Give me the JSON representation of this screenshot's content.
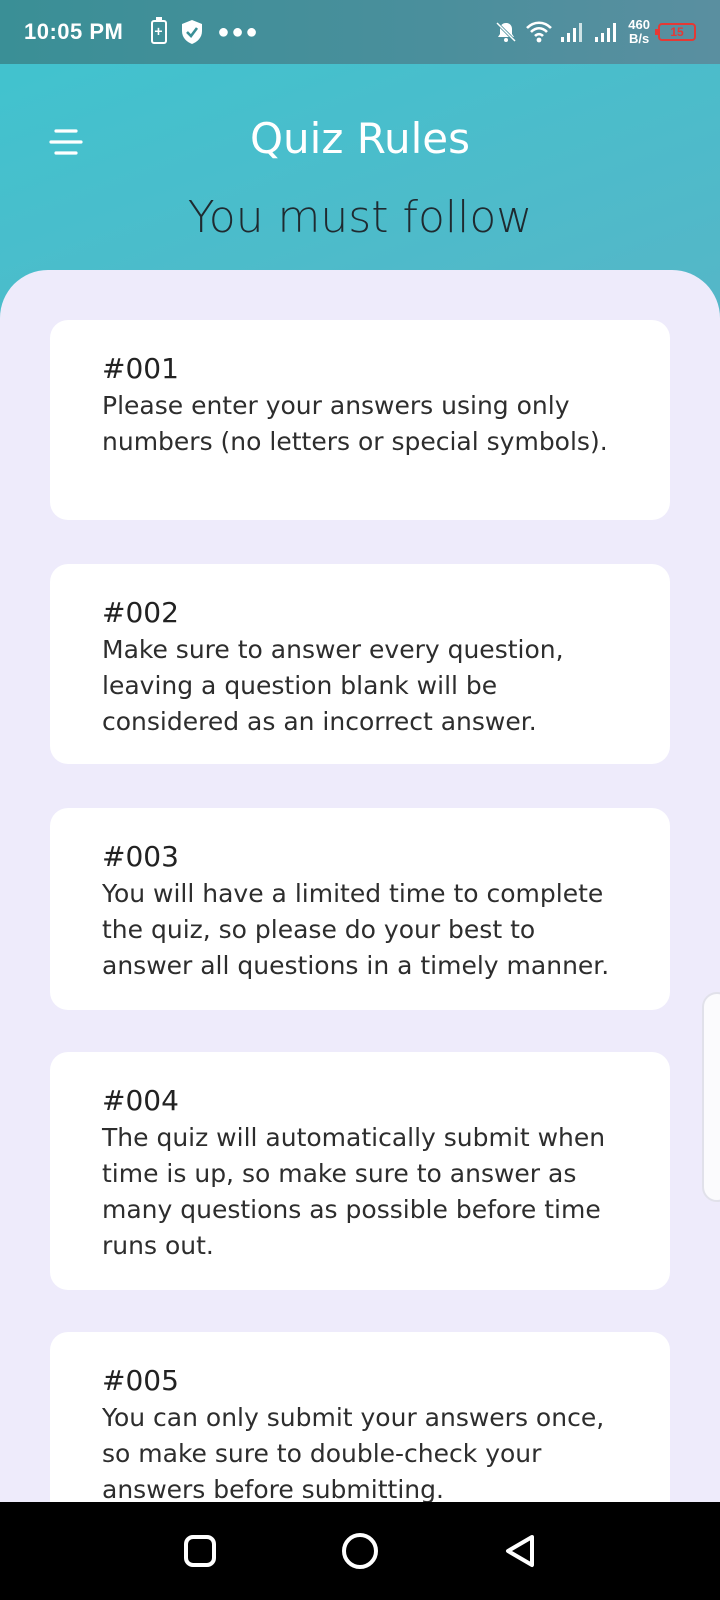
{
  "status_bar": {
    "time": "10:05 PM",
    "net_speed_value": "460",
    "net_speed_unit": "B/s",
    "battery_level": "15",
    "battery_color": "#e53935"
  },
  "header": {
    "title": "Quiz Rules",
    "subtitle": "You must follow"
  },
  "rules": [
    {
      "number": "#001",
      "text": "Please enter your answers using only numbers (no letters or special symbols)."
    },
    {
      "number": "#002",
      "text": "Make sure to answer every question, leaving a question blank will be considered as an incorrect answer."
    },
    {
      "number": "#003",
      "text": "You will have a limited time to complete the quiz, so please do your best to answer all questions in a timely manner."
    },
    {
      "number": "#004",
      "text": "The quiz will automatically submit when time is up, so make sure to answer as many questions as possible before time runs out."
    },
    {
      "number": "#005",
      "text": "You can only submit your answers once, so make sure to double-check your answers before submitting."
    }
  ],
  "nav_bar": {
    "icons": [
      "square-icon",
      "circle-icon",
      "triangle-back-icon"
    ]
  },
  "colors": {
    "content_background": "#eeebfb",
    "card_background": "#ffffff",
    "header_gradient_start": "#3fc4cf",
    "header_gradient_end": "#7a9eb8"
  }
}
